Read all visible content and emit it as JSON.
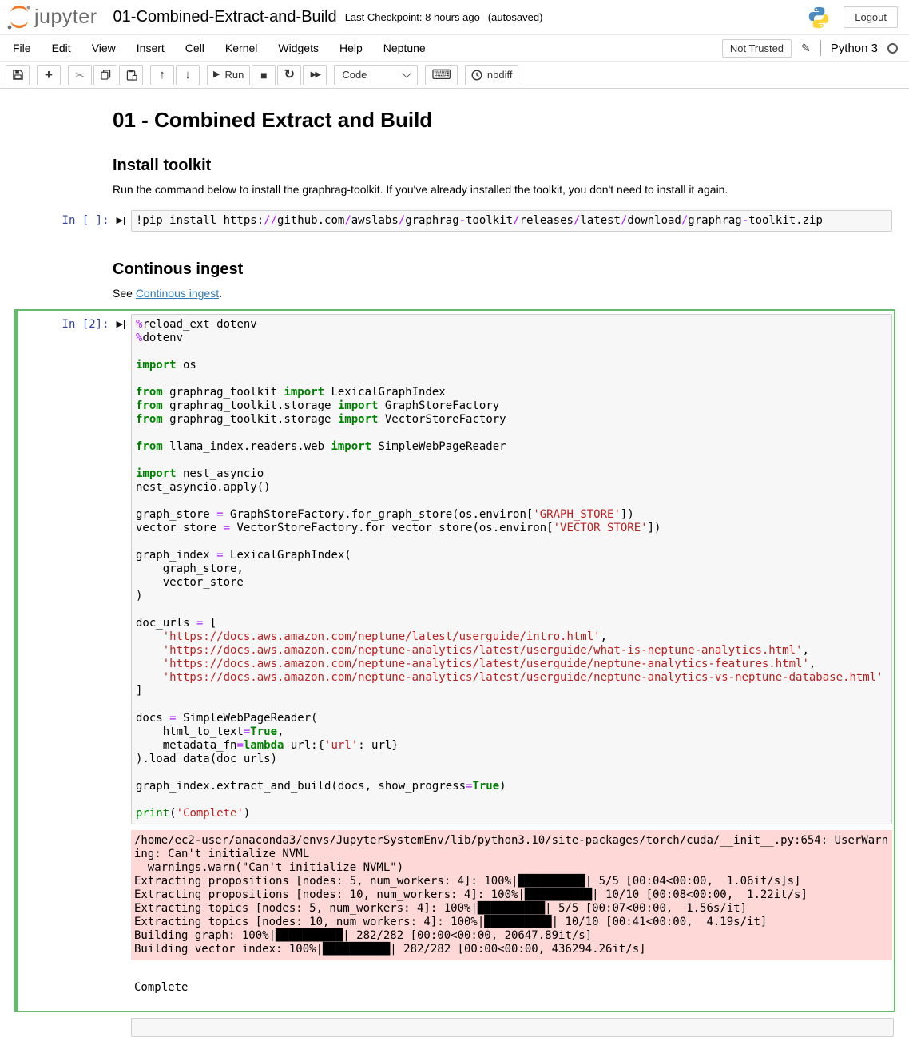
{
  "header": {
    "logo_text": "jupyter",
    "notebook_title": "01-Combined-Extract-and-Build",
    "checkpoint": "Last Checkpoint: 8 hours ago",
    "autosaved": "(autosaved)",
    "logout_label": "Logout"
  },
  "menu": {
    "items": [
      "File",
      "Edit",
      "View",
      "Insert",
      "Cell",
      "Kernel",
      "Widgets",
      "Help",
      "Neptune"
    ],
    "trust_status": "Not Trusted",
    "kernel_name": "Python 3"
  },
  "toolbar": {
    "run_label": "Run",
    "cell_type_selected": "Code",
    "nbdiff_label": "nbdiff"
  },
  "icons": {
    "add": "+",
    "cut": "✂",
    "up": "↑",
    "down": "↓",
    "play": "▶",
    "stop": "■",
    "restart": "↻",
    "fast_forward": "▶▶",
    "keyboard": "⌨",
    "pencil": "✎"
  },
  "markdown": {
    "title": "01 - Combined Extract and Build",
    "install_heading": "Install toolkit",
    "install_text": "Run the command below to install the graphrag-toolkit. If you've already installed the toolkit, you don't need to install it again.",
    "ingest_heading": "Continous ingest",
    "ingest_prefix": "See ",
    "ingest_link": "Continous ingest",
    "ingest_suffix": "."
  },
  "cell1": {
    "prompt": "In [ ]:",
    "code_tokens": [
      [
        [
          "n",
          "!pip install https:"
        ],
        [
          "o",
          "//"
        ],
        [
          "n",
          "github.com"
        ],
        [
          "o",
          "/"
        ],
        [
          "n",
          "awslabs"
        ],
        [
          "o",
          "/"
        ],
        [
          "n",
          "graphrag"
        ],
        [
          "o",
          "-"
        ],
        [
          "n",
          "toolkit"
        ],
        [
          "o",
          "/"
        ],
        [
          "n",
          "releases"
        ],
        [
          "o",
          "/"
        ],
        [
          "n",
          "latest"
        ],
        [
          "o",
          "/"
        ],
        [
          "n",
          "download"
        ],
        [
          "o",
          "/"
        ],
        [
          "n",
          "graphrag"
        ],
        [
          "o",
          "-"
        ],
        [
          "n",
          "toolkit.zip"
        ]
      ]
    ]
  },
  "cell2": {
    "prompt": "In [2]:",
    "code_tokens": [
      [
        [
          "o",
          "%"
        ],
        [
          "n",
          "reload_ext dotenv"
        ]
      ],
      [
        [
          "o",
          "%"
        ],
        [
          "n",
          "dotenv"
        ]
      ],
      [],
      [
        [
          "k",
          "import"
        ],
        [
          "n",
          " os"
        ]
      ],
      [],
      [
        [
          "k",
          "from"
        ],
        [
          "n",
          " graphrag_toolkit "
        ],
        [
          "k",
          "import"
        ],
        [
          "n",
          " LexicalGraphIndex"
        ]
      ],
      [
        [
          "k",
          "from"
        ],
        [
          "n",
          " graphrag_toolkit.storage "
        ],
        [
          "k",
          "import"
        ],
        [
          "n",
          " GraphStoreFactory"
        ]
      ],
      [
        [
          "k",
          "from"
        ],
        [
          "n",
          " graphrag_toolkit.storage "
        ],
        [
          "k",
          "import"
        ],
        [
          "n",
          " VectorStoreFactory"
        ]
      ],
      [],
      [
        [
          "k",
          "from"
        ],
        [
          "n",
          " llama_index.readers.web "
        ],
        [
          "k",
          "import"
        ],
        [
          "n",
          " SimpleWebPageReader"
        ]
      ],
      [],
      [
        [
          "k",
          "import"
        ],
        [
          "n",
          " nest_asyncio"
        ]
      ],
      [
        [
          "n",
          "nest_asyncio.apply()"
        ]
      ],
      [],
      [
        [
          "n",
          "graph_store "
        ],
        [
          "o",
          "="
        ],
        [
          "n",
          " GraphStoreFactory.for_graph_store(os.environ["
        ],
        [
          "s",
          "'GRAPH_STORE'"
        ],
        [
          "n",
          "])"
        ]
      ],
      [
        [
          "n",
          "vector_store "
        ],
        [
          "o",
          "="
        ],
        [
          "n",
          " VectorStoreFactory.for_vector_store(os.environ["
        ],
        [
          "s",
          "'VECTOR_STORE'"
        ],
        [
          "n",
          "])"
        ]
      ],
      [],
      [
        [
          "n",
          "graph_index "
        ],
        [
          "o",
          "="
        ],
        [
          "n",
          " LexicalGraphIndex("
        ]
      ],
      [
        [
          "n",
          "    graph_store,"
        ]
      ],
      [
        [
          "n",
          "    vector_store"
        ]
      ],
      [
        [
          "n",
          ")"
        ]
      ],
      [],
      [
        [
          "n",
          "doc_urls "
        ],
        [
          "o",
          "="
        ],
        [
          "n",
          " ["
        ]
      ],
      [
        [
          "n",
          "    "
        ],
        [
          "s",
          "'https://docs.aws.amazon.com/neptune/latest/userguide/intro.html'"
        ],
        [
          "n",
          ","
        ]
      ],
      [
        [
          "n",
          "    "
        ],
        [
          "s",
          "'https://docs.aws.amazon.com/neptune-analytics/latest/userguide/what-is-neptune-analytics.html'"
        ],
        [
          "n",
          ","
        ]
      ],
      [
        [
          "n",
          "    "
        ],
        [
          "s",
          "'https://docs.aws.amazon.com/neptune-analytics/latest/userguide/neptune-analytics-features.html'"
        ],
        [
          "n",
          ","
        ]
      ],
      [
        [
          "n",
          "    "
        ],
        [
          "s",
          "'https://docs.aws.amazon.com/neptune-analytics/latest/userguide/neptune-analytics-vs-neptune-database.html'"
        ]
      ],
      [
        [
          "n",
          "]"
        ]
      ],
      [],
      [
        [
          "n",
          "docs "
        ],
        [
          "o",
          "="
        ],
        [
          "n",
          " SimpleWebPageReader("
        ]
      ],
      [
        [
          "n",
          "    html_to_text"
        ],
        [
          "o",
          "="
        ],
        [
          "k",
          "True"
        ],
        [
          "n",
          ","
        ]
      ],
      [
        [
          "n",
          "    metadata_fn"
        ],
        [
          "o",
          "="
        ],
        [
          "k",
          "lambda"
        ],
        [
          "n",
          " url:{"
        ],
        [
          "s",
          "'url'"
        ],
        [
          "n",
          ": url}"
        ]
      ],
      [
        [
          "n",
          ").load_data(doc_urls)"
        ]
      ],
      [],
      [
        [
          "n",
          "graph_index.extract_and_build(docs, show_progress"
        ],
        [
          "o",
          "="
        ],
        [
          "k",
          "True"
        ],
        [
          "n",
          ")"
        ]
      ],
      [],
      [
        [
          "b",
          "print"
        ],
        [
          "n",
          "("
        ],
        [
          "s",
          "'Complete'"
        ],
        [
          "n",
          ")"
        ]
      ]
    ],
    "stderr_lines": [
      "/home/ec2-user/anaconda3/envs/JupyterSystemEnv/lib/python3.10/site-packages/torch/cuda/__init__.py:654: UserWarning: Can't initialize NVML",
      "  warnings.warn(\"Can't initialize NVML\")",
      "Extracting propositions [nodes: 5, num_workers: 4]: 100%|██████████| 5/5 [00:04<00:00,  1.06it/s]s]",
      "Extracting propositions [nodes: 10, num_workers: 4]: 100%|██████████| 10/10 [00:08<00:00,  1.22it/s]",
      "Extracting topics [nodes: 5, num_workers: 4]: 100%|██████████| 5/5 [00:07<00:00,  1.56s/it]",
      "Extracting topics [nodes: 10, num_workers: 4]: 100%|██████████| 10/10 [00:41<00:00,  4.19s/it]",
      "Building graph: 100%|██████████| 282/282 [00:00<00:00, 20647.89it/s]",
      "Building vector index: 100%|██████████| 282/282 [00:00<00:00, 436294.26it/s]"
    ],
    "stdout": "Complete"
  },
  "colors": {
    "jupyter_orange": "#F37726",
    "prompt_blue": "#303F9F",
    "keyword_green": "#008000",
    "operator_purple": "#AA22FF",
    "string_red": "#BA2121",
    "stderr_pink": "#FDD8D7",
    "selected_cell_green": "#66BB6A",
    "link_blue": "#337AB7"
  }
}
